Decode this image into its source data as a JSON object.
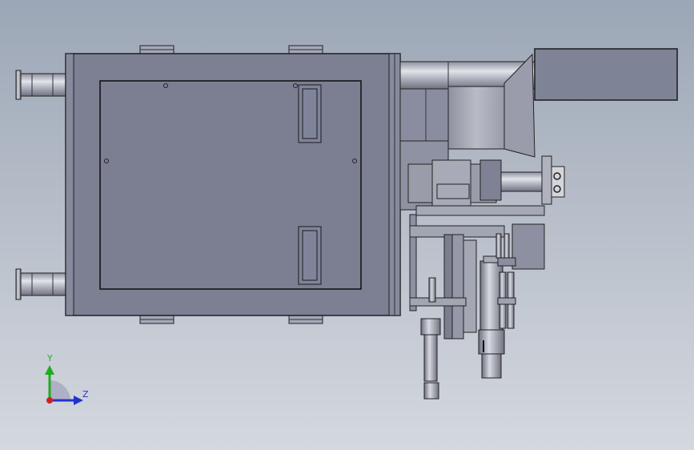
{
  "viewport": {
    "background_top": "#9ba6b6",
    "background_bottom": "#d4d8df"
  },
  "triad": {
    "y_label": "Y",
    "z_label": "Z",
    "y_color": "#22aa22",
    "z_color": "#2233cc",
    "origin_color": "#cc2222"
  }
}
